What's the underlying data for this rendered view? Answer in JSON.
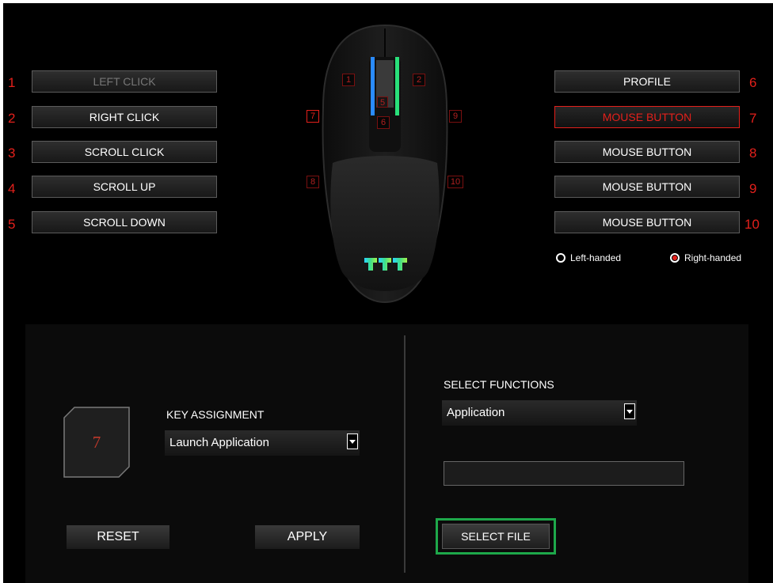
{
  "left_buttons": [
    {
      "number": "1",
      "label": "LEFT CLICK"
    },
    {
      "number": "2",
      "label": "RIGHT CLICK"
    },
    {
      "number": "3",
      "label": "SCROLL CLICK"
    },
    {
      "number": "4",
      "label": "SCROLL UP"
    },
    {
      "number": "5",
      "label": "SCROLL DOWN"
    }
  ],
  "right_buttons": [
    {
      "number": "6",
      "label": "PROFILE"
    },
    {
      "number": "7",
      "label": "MOUSE BUTTON"
    },
    {
      "number": "8",
      "label": "MOUSE BUTTON"
    },
    {
      "number": "9",
      "label": "MOUSE BUTTON"
    },
    {
      "number": "10",
      "label": "MOUSE BUTTON"
    }
  ],
  "mouse_tags": [
    "1",
    "2",
    "5",
    "6",
    "7",
    "9",
    "8",
    "10"
  ],
  "handedness": {
    "left_label": "Left-handed",
    "right_label": "Right-handed",
    "selected": "right"
  },
  "assignment": {
    "key_number": "7",
    "key_assignment_label": "KEY ASSIGNMENT",
    "key_assignment_value": "Launch Application",
    "reset_label": "RESET",
    "apply_label": "APPLY"
  },
  "functions": {
    "select_functions_label": "SELECT FUNCTIONS",
    "select_functions_value": "Application",
    "file_path_value": "",
    "select_file_label": "SELECT FILE"
  },
  "colors": {
    "accent_red": "#e3201b",
    "highlight_green": "#1ea84a",
    "logo_gradient": [
      "#2ad4ff",
      "#3ee08a",
      "#a6f04a"
    ]
  }
}
